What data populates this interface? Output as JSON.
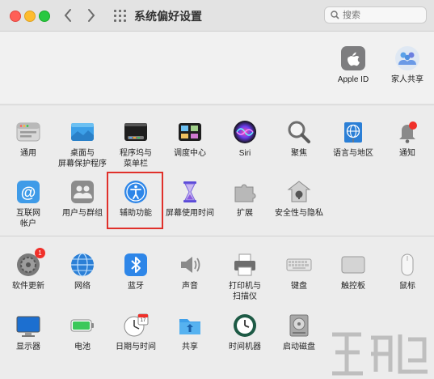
{
  "window": {
    "title": "系统偏好设置"
  },
  "search": {
    "placeholder": "搜索"
  },
  "account": [
    {
      "label": "Apple ID",
      "icon": "apple-id-icon"
    },
    {
      "label": "家人共享",
      "icon": "family-sharing-icon"
    }
  ],
  "row1": [
    {
      "label": "通用",
      "icon": "general-icon"
    },
    {
      "label": "桌面与\n屏幕保护程序",
      "icon": "desktop-screensaver-icon"
    },
    {
      "label": "程序坞与\n菜单栏",
      "icon": "dock-menubar-icon"
    },
    {
      "label": "调度中心",
      "icon": "mission-control-icon"
    },
    {
      "label": "Siri",
      "icon": "siri-icon"
    },
    {
      "label": "聚焦",
      "icon": "spotlight-icon"
    },
    {
      "label": "语言与地区",
      "icon": "language-region-icon"
    },
    {
      "label": "通知",
      "icon": "notifications-icon"
    }
  ],
  "row2": [
    {
      "label": "互联网\n帐户",
      "icon": "internet-accounts-icon"
    },
    {
      "label": "用户与群组",
      "icon": "users-groups-icon"
    },
    {
      "label": "辅助功能",
      "icon": "accessibility-icon"
    },
    {
      "label": "屏幕使用时间",
      "icon": "screen-time-icon"
    },
    {
      "label": "扩展",
      "icon": "extensions-icon"
    },
    {
      "label": "安全性与隐私",
      "icon": "security-privacy-icon"
    }
  ],
  "row3": [
    {
      "label": "软件更新",
      "icon": "software-update-icon",
      "badge": "1"
    },
    {
      "label": "网络",
      "icon": "network-icon"
    },
    {
      "label": "蓝牙",
      "icon": "bluetooth-icon"
    },
    {
      "label": "声音",
      "icon": "sound-icon"
    },
    {
      "label": "打印机与\n扫描仪",
      "icon": "printers-scanners-icon"
    },
    {
      "label": "键盘",
      "icon": "keyboard-icon"
    },
    {
      "label": "触控板",
      "icon": "trackpad-icon"
    },
    {
      "label": "鼠标",
      "icon": "mouse-icon"
    }
  ],
  "row4": [
    {
      "label": "显示器",
      "icon": "displays-icon"
    },
    {
      "label": "电池",
      "icon": "battery-icon"
    },
    {
      "label": "日期与时间",
      "icon": "date-time-icon",
      "calendar_day": "17"
    },
    {
      "label": "共享",
      "icon": "sharing-icon"
    },
    {
      "label": "时间机器",
      "icon": "time-machine-icon"
    },
    {
      "label": "启动磁盘",
      "icon": "startup-disk-icon"
    }
  ]
}
